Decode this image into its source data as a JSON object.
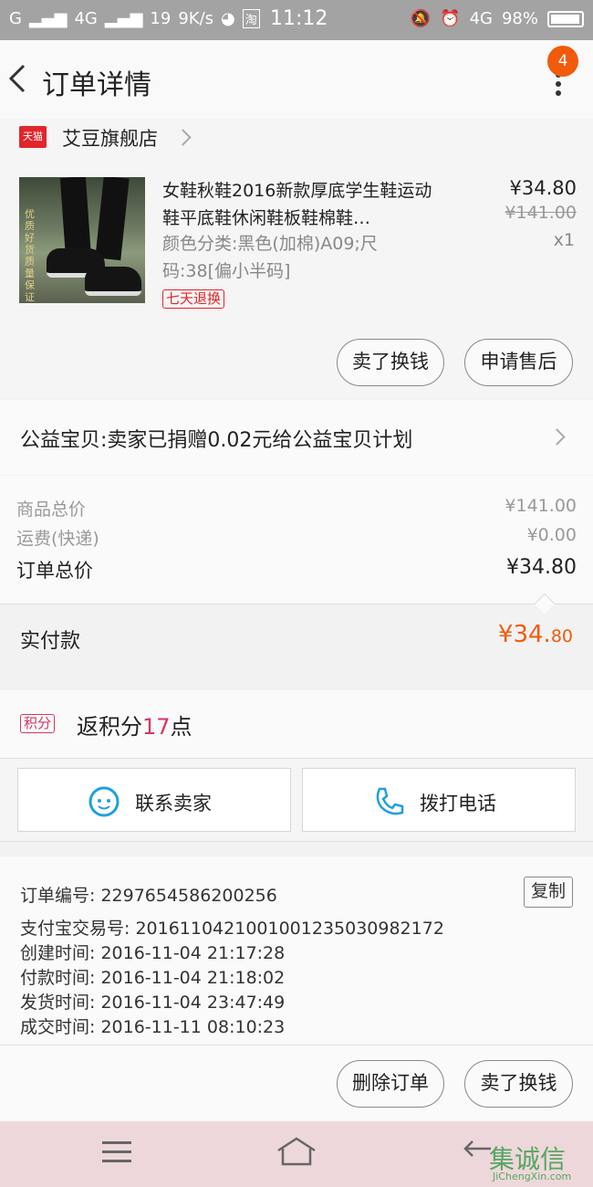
{
  "status_bar": {
    "carrier": "G",
    "network": "4G",
    "notif_count": "19",
    "speed": "9K/s",
    "app1": "QQ",
    "app2": "淘",
    "time": "11:12",
    "net2": "4G",
    "battery": "98%"
  },
  "nav": {
    "title": "订单详情",
    "badge": "4"
  },
  "store": {
    "badge": "天猫",
    "name": "艾豆旗舰店"
  },
  "item": {
    "title": "女鞋秋鞋2016新款厚底学生鞋运动鞋平底鞋休闲鞋板鞋棉鞋…",
    "attr": "颜色分类:黑色(加棉)A09;尺码:38[偏小半码]",
    "tag": "七天退换",
    "price": "¥34.80",
    "original_price": "¥141.00",
    "qty": "x1",
    "image_watermark": "优质好货质量保证"
  },
  "item_actions": {
    "sell": "卖了换钱",
    "after_sale": "申请售后"
  },
  "charity": {
    "text": "公益宝贝:卖家已捐赠0.02元给公益宝贝计划"
  },
  "summary": {
    "goods_label": "商品总价",
    "goods_value": "¥141.00",
    "shipping_label": "运费(快递)",
    "shipping_value": "¥0.00",
    "total_label": "订单总价",
    "total_value": "¥34.80",
    "paid_label": "实付款",
    "paid_int": "¥34.",
    "paid_dec": "80"
  },
  "points": {
    "tag": "积分",
    "prefix": "返积分",
    "num": "17",
    "suffix": "点"
  },
  "contact": {
    "seller": "联系卖家",
    "phone": "拨打电话"
  },
  "info": {
    "order_no": "订单编号: 2297654586200256",
    "alipay_no": "支付宝交易号: 2016110421001001235030982172",
    "created": "创建时间: 2016-11-04  21:17:28",
    "paid": "付款时间: 2016-11-04  21:18:02",
    "shipped": "发货时间: 2016-11-04  23:47:49",
    "done": "成交时间: 2016-11-11  08:10:23",
    "copy": "复制"
  },
  "footer_actions": {
    "delete": "删除订单",
    "sell": "卖了换钱"
  },
  "watermark": {
    "text": "集诚信",
    "sub": "JiChengXin.com"
  },
  "colors": {
    "accent": "#f25a0c",
    "tmall": "#e3242b",
    "points": "#d4365e"
  }
}
